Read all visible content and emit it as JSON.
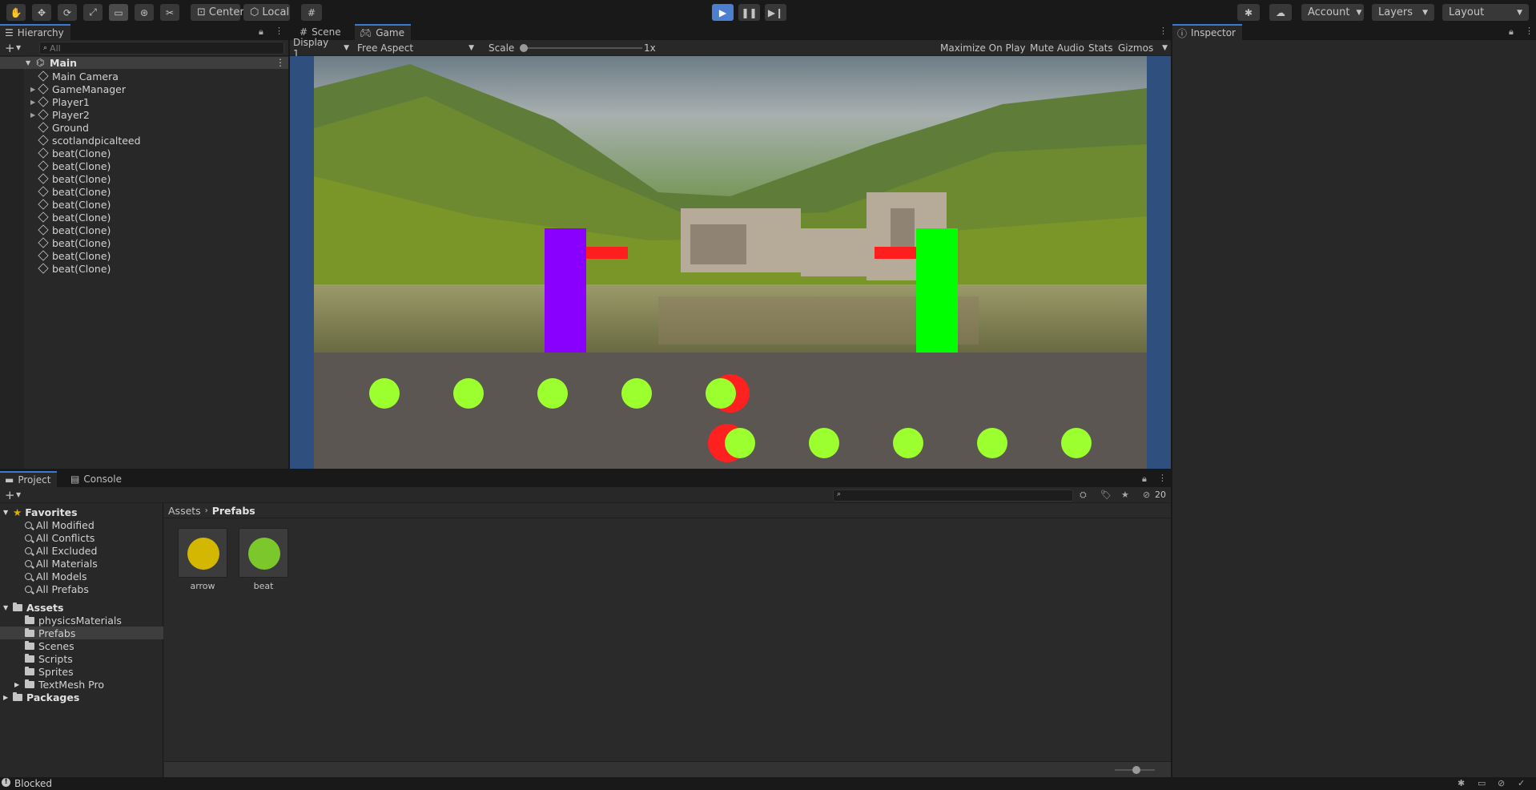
{
  "toolbar": {
    "pivot_label": "Center",
    "space_label": "Local",
    "account_label": "Account",
    "layers_label": "Layers",
    "layout_label": "Layout",
    "tools": [
      "hand-tool-icon",
      "move-tool-icon",
      "rotate-tool-icon",
      "scale-tool-icon",
      "rect-tool-icon",
      "transform-tool-icon",
      "custom-tool-icon"
    ],
    "play_color": "#4c7fd0"
  },
  "hierarchy": {
    "tab_label": "Hierarchy",
    "search_placeholder": "All",
    "scene_name": "Main",
    "items": [
      {
        "label": "Main Camera",
        "expandable": false
      },
      {
        "label": "GameManager",
        "expandable": true
      },
      {
        "label": "Player1",
        "expandable": true
      },
      {
        "label": "Player2",
        "expandable": true
      },
      {
        "label": "Ground",
        "expandable": false
      },
      {
        "label": "scotlandpicalteed",
        "expandable": false
      },
      {
        "label": "beat(Clone)",
        "expandable": false
      },
      {
        "label": "beat(Clone)",
        "expandable": false
      },
      {
        "label": "beat(Clone)",
        "expandable": false
      },
      {
        "label": "beat(Clone)",
        "expandable": false
      },
      {
        "label": "beat(Clone)",
        "expandable": false
      },
      {
        "label": "beat(Clone)",
        "expandable": false
      },
      {
        "label": "beat(Clone)",
        "expandable": false
      },
      {
        "label": "beat(Clone)",
        "expandable": false
      },
      {
        "label": "beat(Clone)",
        "expandable": false
      },
      {
        "label": "beat(Clone)",
        "expandable": false
      }
    ]
  },
  "game_view": {
    "tabs": [
      "Scene",
      "Game"
    ],
    "display": "Display 1",
    "aspect": "Free Aspect",
    "scale_label": "Scale",
    "scale_value": "1x",
    "maximize_label": "Maximize On Play",
    "mute_label": "Mute Audio",
    "stats_label": "Stats",
    "gizmos_label": "Gizmos",
    "player1_color": "#8a00ff",
    "player2_color": "#00ff00",
    "beat_color": "#9cff2e",
    "arrow_color": "#ff2020",
    "ground_color": "#5b5652"
  },
  "inspector": {
    "tab_label": "Inspector"
  },
  "project": {
    "tabs": [
      "Project",
      "Console"
    ],
    "search_placeholder": "",
    "hidden_count": "20",
    "favorites_label": "Favorites",
    "favorites": [
      "All Modified",
      "All Conflicts",
      "All Excluded",
      "All Materials",
      "All Models",
      "All Prefabs"
    ],
    "assets_label": "Assets",
    "asset_folders": [
      {
        "label": "physicsMaterials",
        "expandable": false
      },
      {
        "label": "Prefabs",
        "expandable": false
      },
      {
        "label": "Scenes",
        "expandable": false
      },
      {
        "label": "Scripts",
        "expandable": false
      },
      {
        "label": "Sprites",
        "expandable": false
      },
      {
        "label": "TextMesh Pro",
        "expandable": true
      }
    ],
    "packages_label": "Packages",
    "breadcrumb": [
      "Assets",
      "Prefabs"
    ],
    "prefabs": [
      {
        "label": "arrow",
        "color": "#d4b700"
      },
      {
        "label": "beat",
        "color": "#7cc72c"
      }
    ]
  },
  "status": {
    "message": "Blocked"
  }
}
